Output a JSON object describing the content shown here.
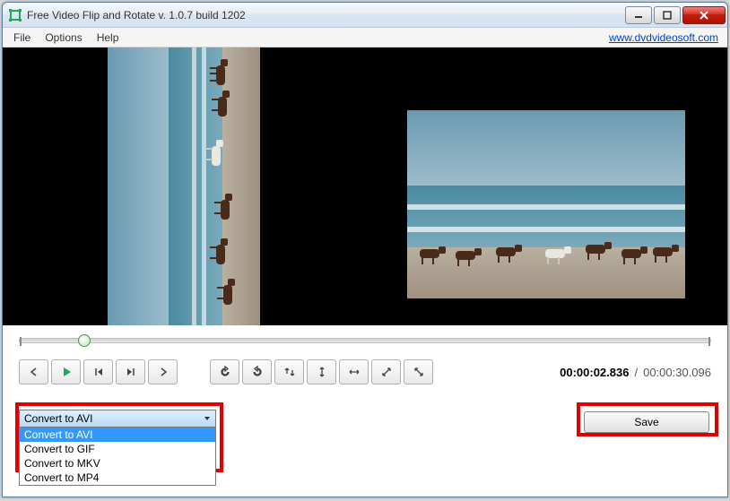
{
  "window": {
    "title": "Free Video Flip and Rotate v. 1.0.7 build 1202"
  },
  "menu": {
    "file": "File",
    "options": "Options",
    "help": "Help",
    "link": "www.dvdvideosoft.com"
  },
  "playback": {
    "position_percent": 9.4,
    "current_time": "00:00:02.836",
    "total_time": "00:00:30.096"
  },
  "format_dropdown": {
    "selected": "Convert to AVI",
    "options": [
      "Convert to AVI",
      "Convert to GIF",
      "Convert to MKV",
      "Convert to MP4"
    ],
    "highlighted_index": 0
  },
  "buttons": {
    "save": "Save"
  },
  "icons": {
    "prev_frame": "arrow-left-icon",
    "play": "play-icon",
    "step_back": "skip-back-icon",
    "step_fwd": "skip-forward-icon",
    "next_frame": "arrow-right-icon",
    "rotate_ccw": "rotate-ccw-icon",
    "rotate_cw": "rotate-cw-icon",
    "flip_h_then_rotate": "flip-rotate-icon",
    "flip_v": "flip-vertical-icon",
    "flip_h": "flip-horizontal-icon",
    "diag1": "flip-diag1-icon",
    "diag2": "flip-diag2-icon"
  },
  "colors": {
    "accent_green": "#1aaa5a",
    "highlight_red": "#e00000"
  }
}
